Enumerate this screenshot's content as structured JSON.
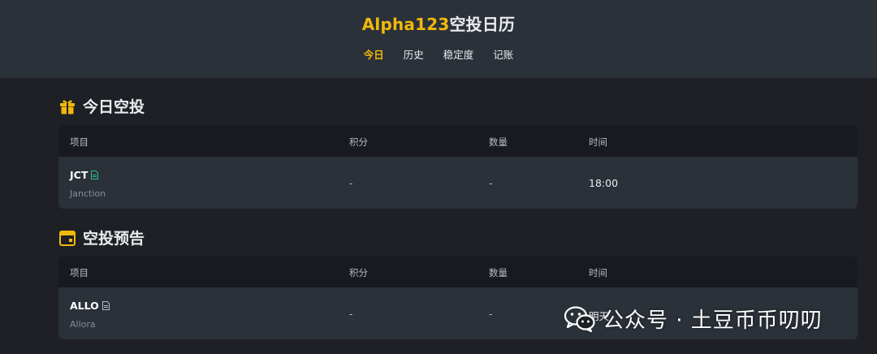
{
  "header": {
    "title_brand": "Alpha123",
    "title_rest": "空投日历",
    "nav": [
      {
        "label": "今日",
        "active": true
      },
      {
        "label": "历史",
        "active": false
      },
      {
        "label": "稳定度",
        "active": false
      },
      {
        "label": "记账",
        "active": false
      }
    ]
  },
  "today": {
    "title": "今日空投",
    "icon": "gift-icon",
    "columns": [
      "项目",
      "积分",
      "数量",
      "时间"
    ],
    "rows": [
      {
        "symbol": "JCT",
        "name": "Janction",
        "points": "-",
        "amount": "-",
        "time": "18:00",
        "doc_color": "#2ebd85"
      }
    ]
  },
  "upcoming": {
    "title": "空投预告",
    "icon": "calendar-icon",
    "columns": [
      "项目",
      "积分",
      "数量",
      "时间"
    ],
    "rows": [
      {
        "symbol": "ALLO",
        "name": "Allora",
        "points": "-",
        "amount": "-",
        "time": "明天",
        "doc_color": "#b7bdc6"
      }
    ]
  },
  "watermark": {
    "text": "公众号 · 土豆币币叨叨",
    "icon": "wechat-icon"
  },
  "colors": {
    "accent": "#f0b90b",
    "background": "#1e2026",
    "panel": "#2b3139"
  }
}
